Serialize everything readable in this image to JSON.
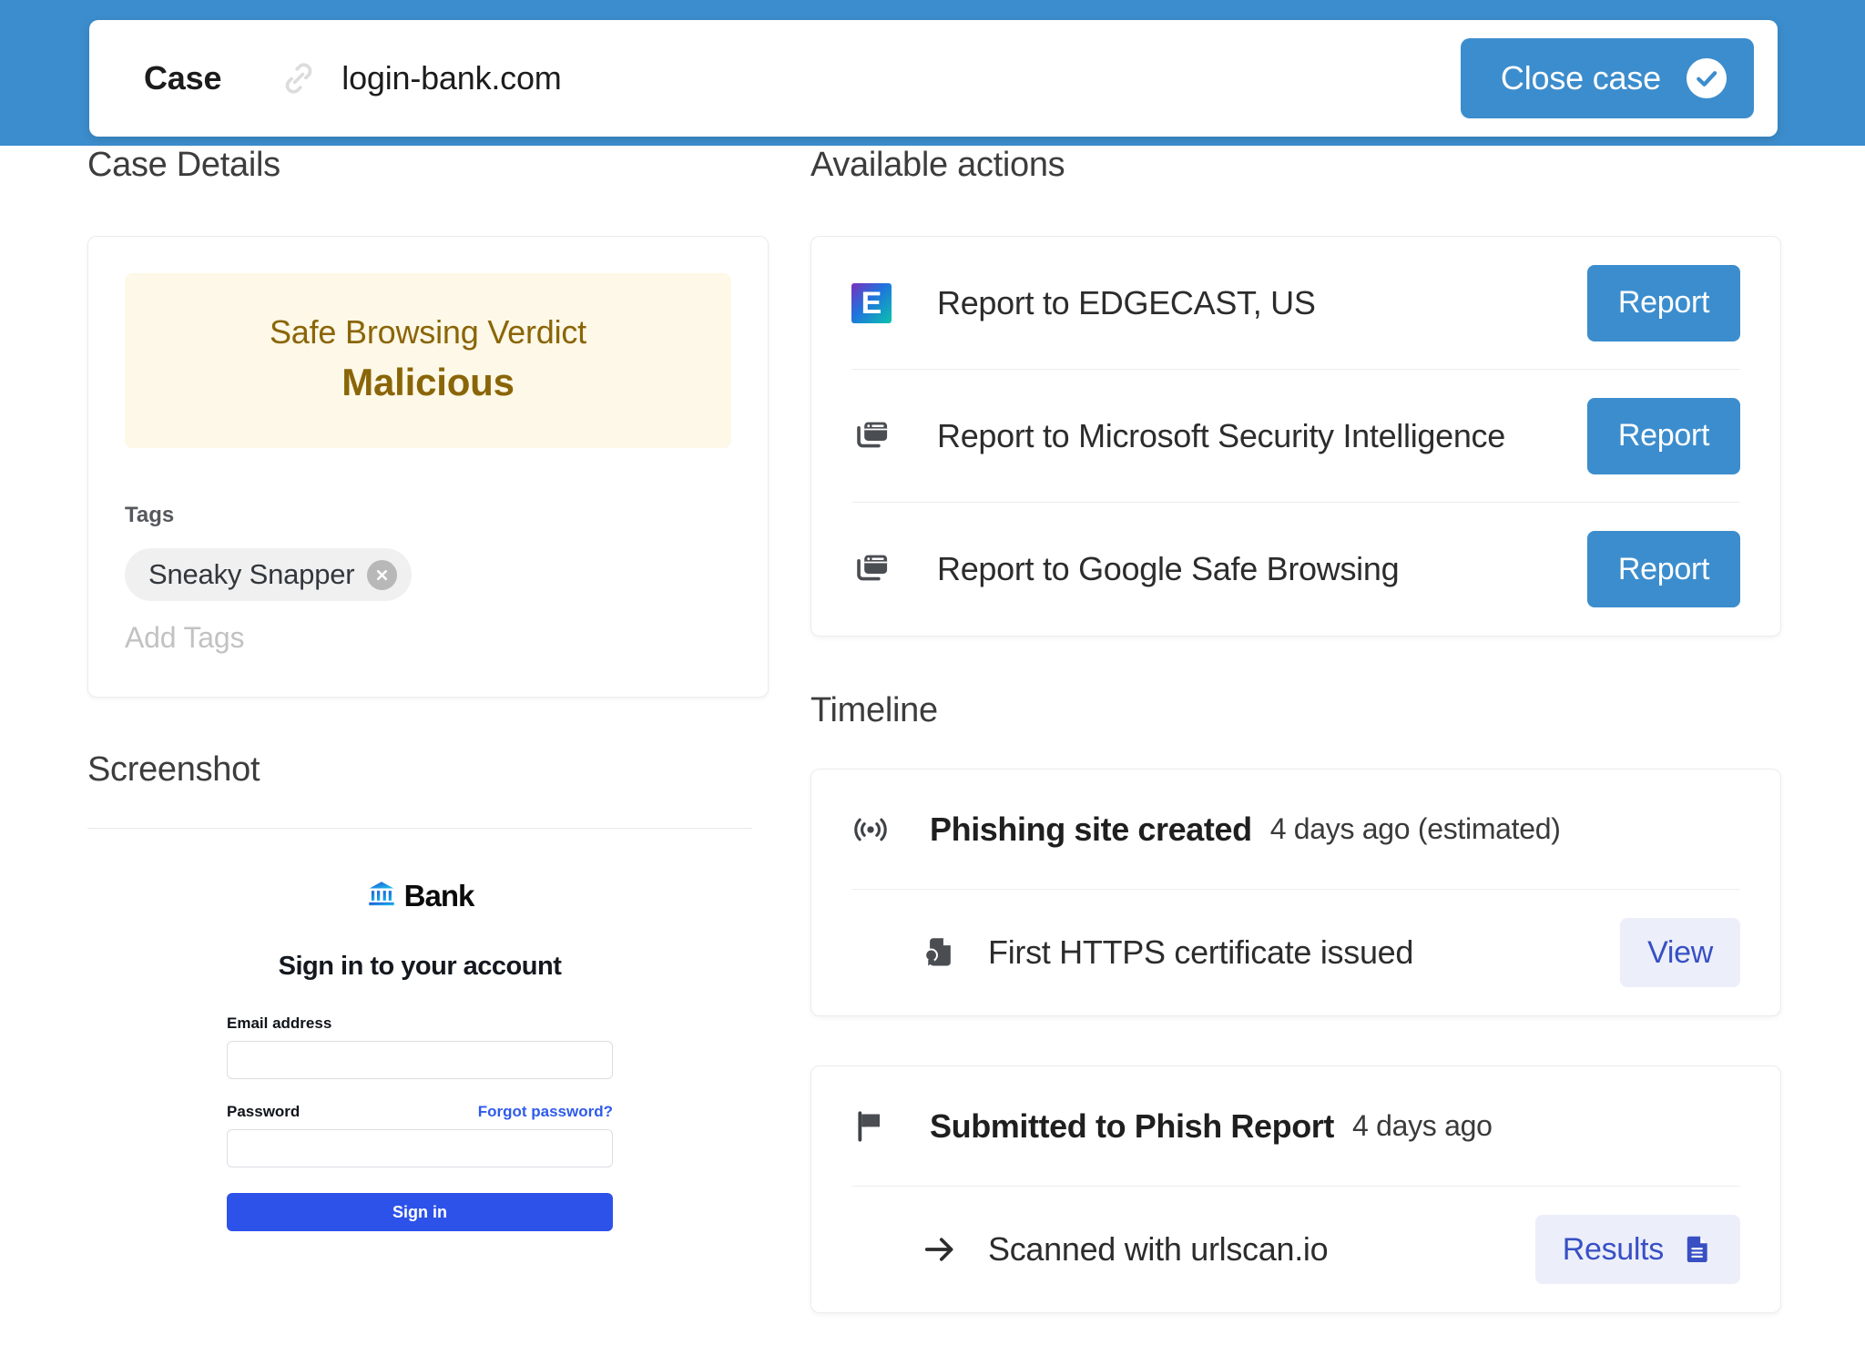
{
  "header": {
    "case_label": "Case",
    "link_icon": "link-icon",
    "url": "login-bank.com",
    "close_button": "Close case",
    "check_icon": "check-circle-icon"
  },
  "case_details": {
    "section_title": "Case Details",
    "verdict": {
      "title": "Safe Browsing Verdict",
      "value": "Malicious",
      "bg_color": "#fdf8e7",
      "text_color": "#8a6508"
    },
    "tags_label": "Tags",
    "tags": [
      {
        "text": "Sneaky Snapper",
        "remove_icon": "close-icon"
      }
    ],
    "add_tags_placeholder": "Add Tags"
  },
  "screenshot": {
    "section_title": "Screenshot",
    "brand": {
      "icon": "bank-building-icon",
      "name": "Bank"
    },
    "heading": "Sign in to your account",
    "email_label": "Email address",
    "email_value": "",
    "password_label": "Password",
    "password_value": "",
    "forgot_link": "Forgot password?",
    "signin_button": "Sign in",
    "primary_color": "#2d52ea"
  },
  "available_actions": {
    "section_title": "Available actions",
    "items": [
      {
        "icon": "edgecast-logo-icon",
        "icon_letter": "E",
        "label": "Report to EDGECAST, US",
        "button": "Report"
      },
      {
        "icon": "browser-windows-icon",
        "label": "Report to Microsoft Security Intelligence",
        "button": "Report"
      },
      {
        "icon": "browser-windows-icon",
        "label": "Report to Google Safe Browsing",
        "button": "Report"
      }
    ],
    "button_color": "#3c8dcd"
  },
  "timeline": {
    "section_title": "Timeline",
    "entries": [
      {
        "icon": "broadcast-icon",
        "title": "Phishing site created",
        "time": "4 days ago (estimated)",
        "sub": {
          "icon": "certificate-icon",
          "label": "First HTTPS certificate issued",
          "button": "View",
          "button_icon": ""
        }
      },
      {
        "icon": "flag-icon",
        "title": "Submitted to Phish Report",
        "time": "4 days ago",
        "sub": {
          "icon": "arrow-right-icon",
          "label": "Scanned with urlscan.io",
          "button": "Results",
          "button_icon": "document-icon"
        }
      }
    ],
    "ghost_button_color": "#3850c4"
  }
}
